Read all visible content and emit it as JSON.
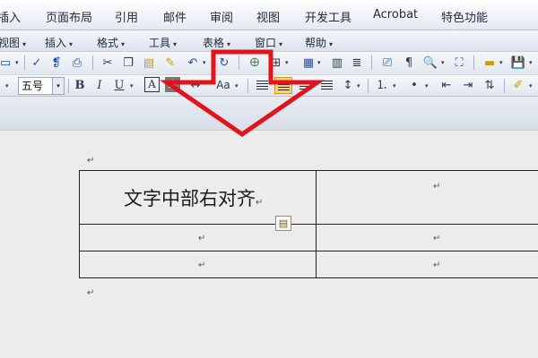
{
  "ribbon_tabs": [
    "插入",
    "页面布局",
    "引用",
    "邮件",
    "审阅",
    "视图",
    "开发工具",
    "Acrobat",
    "特色功能"
  ],
  "menus": [
    "视图",
    "插入",
    "格式",
    "工具",
    "表格",
    "窗口",
    "帮助"
  ],
  "toolbar": {
    "font_size": "五号",
    "bold": "B",
    "italic": "I",
    "underline": "U",
    "char_border": "A",
    "char_shade": "A",
    "case": "Aa"
  },
  "document": {
    "cell_text": "文字中部右对齐",
    "paragraph_mark": "↵"
  },
  "colors": {
    "arrow": "#e0141a",
    "active_button": "#f7d46b"
  }
}
